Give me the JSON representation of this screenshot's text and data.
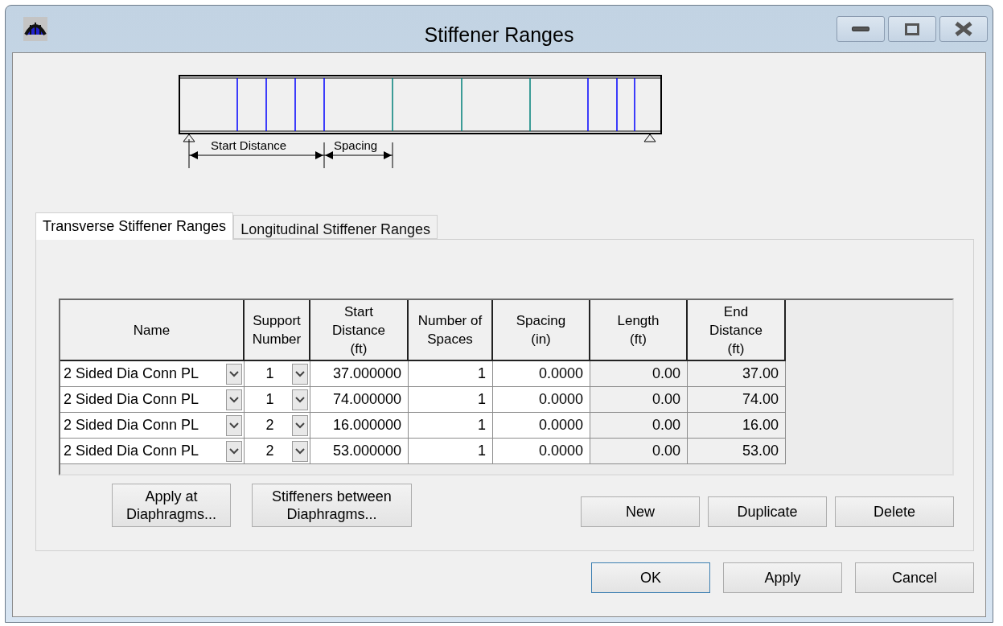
{
  "window": {
    "title": "Stiffener Ranges"
  },
  "diagram": {
    "start_label": "Start Distance",
    "spacing_label": "Spacing"
  },
  "tabs": [
    {
      "label": "Transverse Stiffener Ranges",
      "selected": true
    },
    {
      "label": "Longitudinal Stiffener Ranges",
      "selected": false
    }
  ],
  "table": {
    "columns": [
      {
        "label": [
          "Name"
        ],
        "kind": "dropdown"
      },
      {
        "label": [
          "Support",
          "Number"
        ],
        "kind": "dropdown"
      },
      {
        "label": [
          "Start",
          "Distance",
          "(ft)"
        ],
        "kind": "text"
      },
      {
        "label": [
          "Number of",
          "Spaces"
        ],
        "kind": "text"
      },
      {
        "label": [
          "Spacing",
          "(in)"
        ],
        "kind": "text"
      },
      {
        "label": [
          "Length",
          "(ft)"
        ],
        "kind": "readonly"
      },
      {
        "label": [
          "End",
          "Distance",
          "(ft)"
        ],
        "kind": "readonly"
      }
    ],
    "rows": [
      [
        "2 Sided Dia Conn PL",
        "1",
        "37.000000",
        "1",
        "0.0000",
        "0.00",
        "37.00"
      ],
      [
        "2 Sided Dia Conn PL",
        "1",
        "74.000000",
        "1",
        "0.0000",
        "0.00",
        "74.00"
      ],
      [
        "2 Sided Dia Conn PL",
        "2",
        "16.000000",
        "1",
        "0.0000",
        "0.00",
        "16.00"
      ],
      [
        "2 Sided Dia Conn PL",
        "2",
        "53.000000",
        "1",
        "0.0000",
        "0.00",
        "53.00"
      ]
    ]
  },
  "left_buttons": [
    "Apply at Diaphragms...",
    "Stiffeners between Diaphragms..."
  ],
  "row_buttons": [
    "New",
    "Duplicate",
    "Delete"
  ],
  "dialog_buttons": [
    {
      "label": "OK",
      "focused": true
    },
    {
      "label": "Apply",
      "focused": false
    },
    {
      "label": "Cancel",
      "focused": false
    }
  ]
}
